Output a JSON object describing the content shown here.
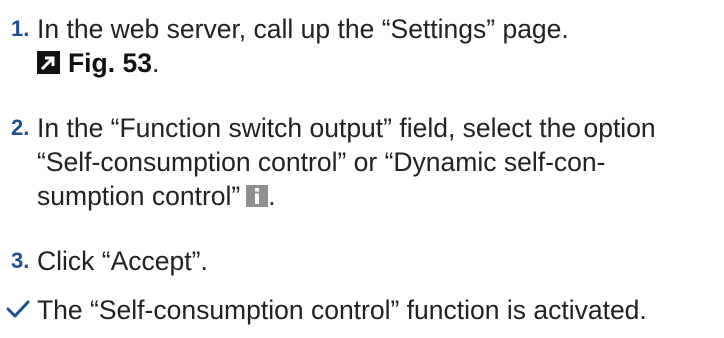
{
  "steps": [
    {
      "number": "1.",
      "line1": "In the web server, call up the “Settings” page.",
      "figure_ref": "Fig. 53",
      "figure_suffix": "."
    },
    {
      "number": "2.",
      "line1": "In the “Function switch output” field, select the option",
      "line2": "“Self-consumption control” or “Dynamic self-con-",
      "line3": "sumption control”",
      "line3_suffix": "."
    },
    {
      "number": "3.",
      "line1": "Click “Accept”."
    }
  ],
  "result": {
    "text": "The “Self-consumption control” function is activated."
  },
  "colors": {
    "step_number": "#1d4f91",
    "info_icon": "#8f8f8f",
    "checkmark": "#1d4f91"
  }
}
